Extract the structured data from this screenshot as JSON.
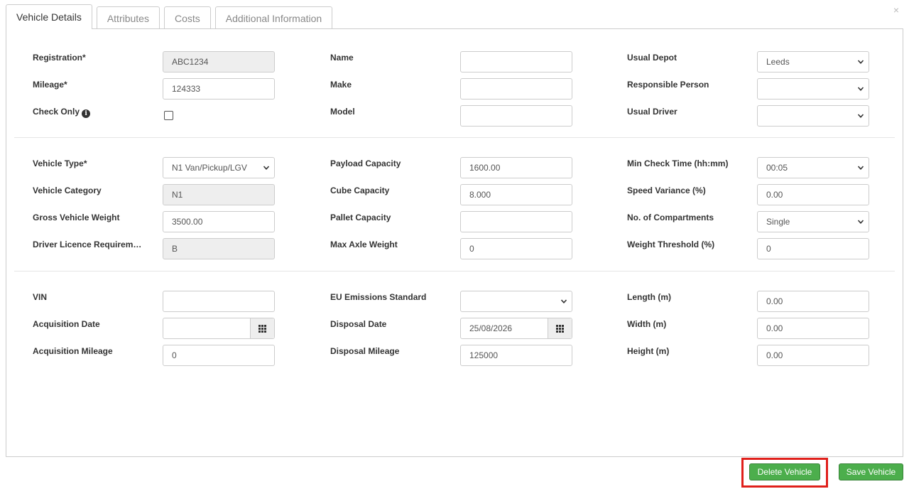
{
  "tabs": [
    {
      "label": "Vehicle Details",
      "active": true
    },
    {
      "label": "Attributes"
    },
    {
      "label": "Costs"
    },
    {
      "label": "Additional Information"
    }
  ],
  "close_symbol": "×",
  "section1": {
    "registration": {
      "label": "Registration*",
      "value": "ABC1234"
    },
    "mileage": {
      "label": "Mileage*",
      "value": "124333"
    },
    "check_only": {
      "label": "Check Only",
      "checked": false
    },
    "name": {
      "label": "Name",
      "value": ""
    },
    "make": {
      "label": "Make",
      "value": ""
    },
    "model": {
      "label": "Model",
      "value": ""
    },
    "usual_depot": {
      "label": "Usual Depot",
      "value": "Leeds"
    },
    "responsible_person": {
      "label": "Responsible Person",
      "value": ""
    },
    "usual_driver": {
      "label": "Usual Driver",
      "value": ""
    }
  },
  "section2": {
    "vehicle_type": {
      "label": "Vehicle Type*",
      "value": "N1 Van/Pickup/LGV"
    },
    "vehicle_category": {
      "label": "Vehicle Category",
      "value": "N1"
    },
    "gross_vehicle_weight": {
      "label": "Gross Vehicle Weight",
      "value": "3500.00"
    },
    "driver_licence": {
      "label": "Driver Licence Requirem…",
      "value": "B"
    },
    "payload_capacity": {
      "label": "Payload Capacity",
      "value": "1600.00"
    },
    "cube_capacity": {
      "label": "Cube Capacity",
      "value": "8.000"
    },
    "pallet_capacity": {
      "label": "Pallet Capacity",
      "value": ""
    },
    "max_axle_weight": {
      "label": "Max Axle Weight",
      "value": "0"
    },
    "min_check_time": {
      "label": "Min Check Time (hh:mm)",
      "value": "00:05"
    },
    "speed_variance": {
      "label": "Speed Variance (%)",
      "value": "0.00"
    },
    "compartments": {
      "label": "No. of Compartments",
      "value": "Single"
    },
    "weight_threshold": {
      "label": "Weight Threshold (%)",
      "value": "0"
    }
  },
  "section3": {
    "vin": {
      "label": "VIN",
      "value": ""
    },
    "acquisition_date": {
      "label": "Acquisition Date",
      "value": ""
    },
    "acquisition_mileage": {
      "label": "Acquisition Mileage",
      "value": "0"
    },
    "eu_emissions": {
      "label": "EU Emissions Standard",
      "value": ""
    },
    "disposal_date": {
      "label": "Disposal Date",
      "value": "25/08/2026"
    },
    "disposal_mileage": {
      "label": "Disposal Mileage",
      "value": "125000"
    },
    "length": {
      "label": "Length (m)",
      "value": "0.00"
    },
    "width": {
      "label": "Width (m)",
      "value": "0.00"
    },
    "height": {
      "label": "Height (m)",
      "value": "0.00"
    }
  },
  "buttons": {
    "delete": "Delete Vehicle",
    "save": "Save Vehicle"
  },
  "colors": {
    "button_green": "#4cae4c",
    "highlight_red": "#e0201b",
    "readonly_bg": "#eeeeee"
  }
}
